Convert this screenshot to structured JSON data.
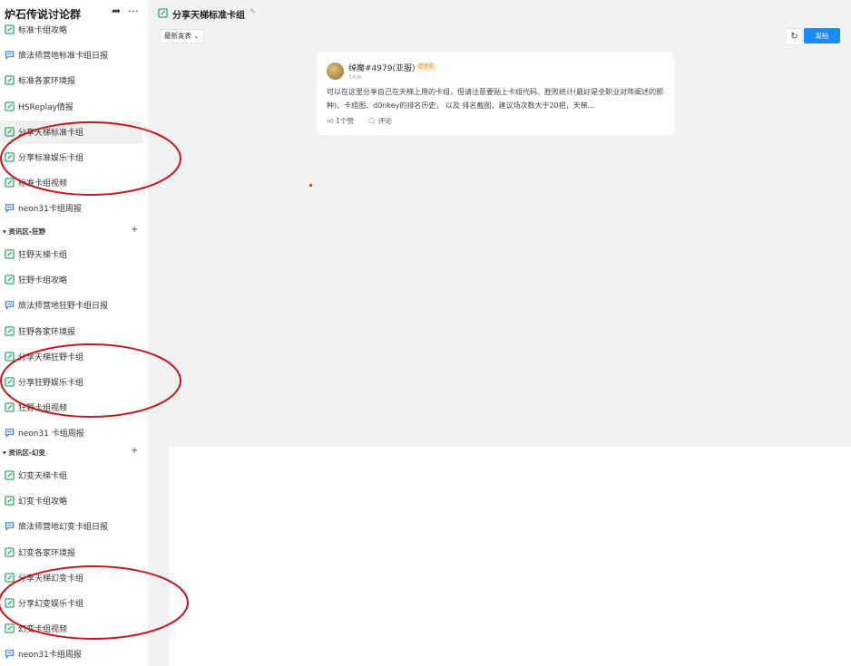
{
  "guild": {
    "name": "炉石传说讨论群",
    "share_icon": "share-arrow-icon",
    "more_icon": "more-dots-icon"
  },
  "sidebar": {
    "standard_channels": [
      {
        "label": "标准卡组攻略",
        "icon": "doc-edit-icon"
      },
      {
        "label": "旅法师营地标准卡组日报",
        "icon": "chat-icon"
      },
      {
        "label": "标准各家环境报",
        "icon": "doc-edit-icon"
      },
      {
        "label": "HSReplay情报",
        "icon": "doc-edit-icon"
      },
      {
        "label": "分享天梯标准卡组",
        "icon": "doc-edit-icon"
      },
      {
        "label": "分享标准娱乐卡组",
        "icon": "doc-edit-icon"
      },
      {
        "label": "标准卡组视频",
        "icon": "doc-edit-icon"
      },
      {
        "label": "neon31卡组周报",
        "icon": "chat-icon"
      }
    ],
    "section_wild": {
      "label": "▾ 资讯区-狂野",
      "plus": "+"
    },
    "wild_channels": [
      {
        "label": "狂野天梯卡组",
        "icon": "doc-edit-icon"
      },
      {
        "label": "狂野卡组攻略",
        "icon": "doc-edit-icon"
      },
      {
        "label": "旅法师营地狂野卡组日报",
        "icon": "chat-icon"
      },
      {
        "label": "狂野各家环境报",
        "icon": "doc-edit-icon"
      },
      {
        "label": "分享天梯狂野卡组",
        "icon": "doc-edit-icon"
      },
      {
        "label": "分享狂野娱乐卡组",
        "icon": "doc-edit-icon"
      },
      {
        "label": "狂野卡组视频",
        "icon": "doc-edit-icon"
      },
      {
        "label": "neon31 卡组周报",
        "icon": "chat-icon"
      }
    ],
    "section_twist": {
      "label": "▾ 资讯区-幻变",
      "plus": "+"
    },
    "twist_channels": [
      {
        "label": "幻变天梯卡组",
        "icon": "doc-edit-icon"
      },
      {
        "label": "幻变卡组攻略",
        "icon": "doc-edit-icon"
      },
      {
        "label": "旅法师营地幻变卡组日报",
        "icon": "chat-icon"
      },
      {
        "label": "幻变各家环境报",
        "icon": "doc-edit-icon"
      },
      {
        "label": "分享天梯幻变卡组",
        "icon": "doc-edit-icon"
      },
      {
        "label": "分享幻变娱乐卡组",
        "icon": "doc-edit-icon"
      },
      {
        "label": "幻变卡组视频",
        "icon": "doc-edit-icon"
      },
      {
        "label": "neon31卡组周报",
        "icon": "chat-icon"
      }
    ]
  },
  "main": {
    "title": "分享天梯标准卡组",
    "sort_label": "最新发表 ⌄",
    "refresh_glyph": "↻",
    "post_label": "发帖"
  },
  "post": {
    "author": "绰魔#4979(亚服)",
    "badge": "管理员",
    "time": "3天前",
    "excerpt": "可以在这里分享自己在天梯上用的卡组，但请注意要贴上卡组代码、胜败统计(最好是全职业对阵阐述的那种)、卡组图、d0nkey的排名历史， 以及 排名截图，建议场次数大于20把，天梯...",
    "likes": "1个赞",
    "comment": "评论"
  },
  "colors": {
    "accent": "#1a8cff",
    "annotation": "#c4161c",
    "channel_icon": "#1aa260"
  }
}
